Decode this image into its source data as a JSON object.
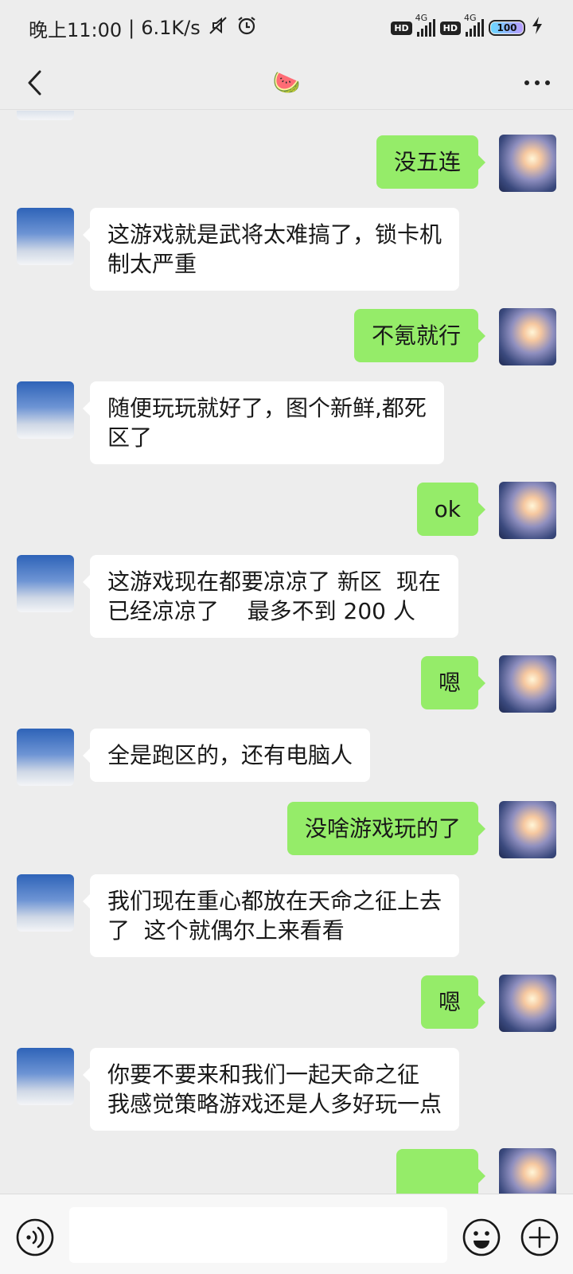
{
  "status": {
    "time": "晚上11:00",
    "speed": "6.1K/s",
    "hd1": "HD",
    "net1": "4G",
    "hd2": "HD",
    "net2": "4G",
    "battery": "100",
    "battery_level": 1.0,
    "icons": [
      "mute-icon",
      "alarm-icon",
      "signal-icon",
      "battery-icon",
      "charging-icon"
    ]
  },
  "header": {
    "title": "🍉",
    "back_icon": "chevron-left-icon",
    "more_icon": "more-icon"
  },
  "messages": [
    {
      "side": "out",
      "text": "没五连"
    },
    {
      "side": "in",
      "lines": [
        "这游戏就是武将太难搞了，锁卡机",
        "制太严重"
      ]
    },
    {
      "side": "out",
      "text": "不氪就行"
    },
    {
      "side": "in",
      "lines": [
        "随便玩玩就好了，图个新鲜,都死",
        "区了"
      ]
    },
    {
      "side": "out",
      "text": "ok"
    },
    {
      "side": "in",
      "lines": [
        "这游戏现在都要凉凉了 新区  现在",
        "已经凉凉了    最多不到 200 人"
      ]
    },
    {
      "side": "out",
      "text": "嗯"
    },
    {
      "side": "in",
      "text": "全是跑区的，还有电脑人"
    },
    {
      "side": "out",
      "text": "没啥游戏玩的了"
    },
    {
      "side": "in",
      "lines": [
        "我们现在重心都放在天命之征上去",
        "了  这个就偶尔上来看看"
      ]
    },
    {
      "side": "out",
      "text": "嗯"
    },
    {
      "side": "in",
      "lines": [
        "你要不要来和我们一起天命之征",
        "我感觉策略游戏还是人多好玩一点"
      ]
    }
  ],
  "input_bar": {
    "placeholder": "",
    "icons": [
      "voice-icon",
      "emoji-icon",
      "plus-icon"
    ]
  }
}
